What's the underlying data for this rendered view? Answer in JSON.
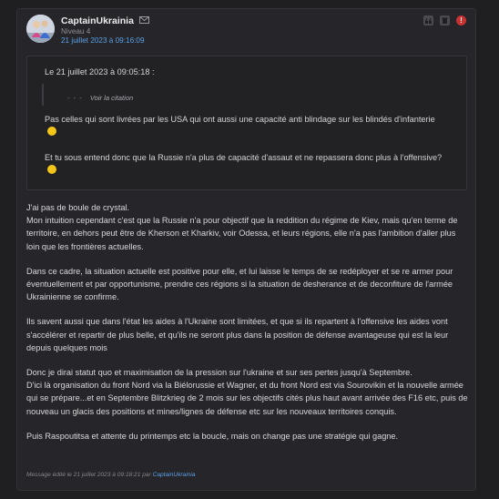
{
  "post": {
    "author": "CaptainUkrainia",
    "level": "Niveau 4",
    "date": "21 juillet 2023 à 09:16:09",
    "icons": {
      "mail": "mail-icon",
      "quote": "quote-icon",
      "delete": "trash-icon",
      "report": "alert-icon"
    },
    "report_symbol": "!"
  },
  "quote": {
    "header": "Le 21 juillet 2023 à 09:05:18 :",
    "nested_toggle_dots": "- - -",
    "nested_toggle_label": "Voir la citation",
    "paragraph1": "Pas celles qui sont livrées par les USA qui ont aussi une capacité anti blindage sur les blindés d'infanterie",
    "paragraph2": "Et tu sous entend donc que la Russie n'a plus de capacité d'assaut et ne repassera donc plus à l'offensive?"
  },
  "body": {
    "paragraphs": [
      "J'ai pas de boule de crystal.\nMon intuition cependant c'est que la Russie n'a pour objectif que la reddition du régime de Kiev, mais qu'en terme de territoire, en dehors peut être de Kherson et Kharkiv, voir Odessa, et leurs régions, elle n'a pas l'ambition d'aller plus loin que les frontières actuelles.",
      "Dans ce cadre, la situation actuelle est positive pour elle, et lui laisse le temps de se redéployer et se re armer pour éventuellement et par opportunisme, prendre ces régions si la situation de desherance et de deconfiture de l'armée Ukrainienne se confirme.",
      "Ils savent aussi que dans l'état les aides à l'Ukraine sont limitées, et que si ils repartent à l'offensive les aides vont s'accélérer et repartir de plus belle, et qu'ils ne seront plus dans la position de défense avantageuse qui est la leur depuis quelques mois",
      "Donc je dirai statut quo et maximisation de la pression sur l'ukraine et sur ses pertes jusqu'à Septembre.\nD'ici là organisation du front Nord via la Biélorussie et Wagner, et du front Nord est via Sourovikin et la nouvelle armée qui se prépare...et en Septembre Blitzkrieg de 2 mois sur les objectifs cités plus haut avant arrivée des F16 etc, puis de nouveau un glacis des positions et mines/lignes de défense etc sur les nouveaux territoires conquis.",
      "Puis Raspoutitsa et attente du printemps etc la boucle, mais on change pas une stratégie qui gagne."
    ]
  },
  "edit_note": {
    "text": "Message édité le 21 juillet 2023 à 09:18:21 par",
    "user": "CaptainUkrainia"
  },
  "colors": {
    "link": "#5aa0e6",
    "alert": "#c83232",
    "emoji": "#f5c518"
  }
}
